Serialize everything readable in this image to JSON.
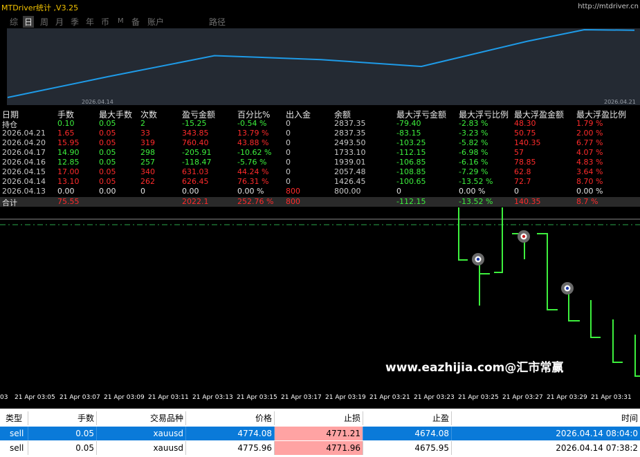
{
  "app": {
    "title": "MTDriver统计 ,V3.25",
    "site": "http://mtdriver.cn"
  },
  "tabs": [
    "综",
    "日",
    "周",
    "月",
    "季",
    "年",
    "币",
    "M",
    "备",
    "账户",
    "路径"
  ],
  "active_tab": "日",
  "curve": {
    "date_left": "2026.04.14",
    "date_right": "2026.04.21",
    "line_color": "#1e9be8",
    "values": [
      0,
      626.45,
      1257.48,
      1139.01,
      933.1,
      1693.5,
      2037.35,
      2022.1
    ]
  },
  "stats": {
    "headers": [
      "日期",
      "手数",
      "最大手数",
      "次数",
      "盈亏金额",
      "百分比%",
      "出入金",
      "余额",
      "最大浮亏金额",
      "最大浮亏比例",
      "最大浮盈金额",
      "最大浮盈比例"
    ],
    "rows": [
      {
        "date": "持仓",
        "lots": "0.10",
        "max_lots": "0.05",
        "count": "2",
        "pnl": "-15.25",
        "pct": "-0.54 %",
        "inout": "0",
        "balance": "2837.35",
        "max_dd": "-79.40",
        "max_dd_pct": "-2.83 %",
        "max_fp": "48.30",
        "max_fp_pct": "1.79 %",
        "tone": "g"
      },
      {
        "date": "2026.04.21",
        "lots": "1.65",
        "max_lots": "0.05",
        "count": "33",
        "pnl": "343.85",
        "pct": "13.79 %",
        "inout": "0",
        "balance": "2837.35",
        "max_dd": "-83.15",
        "max_dd_pct": "-3.23 %",
        "max_fp": "50.75",
        "max_fp_pct": "2.00 %",
        "tone": "r"
      },
      {
        "date": "2026.04.20",
        "lots": "15.95",
        "max_lots": "0.05",
        "count": "319",
        "pnl": "760.40",
        "pct": "43.88 %",
        "inout": "0",
        "balance": "2493.50",
        "max_dd": "-103.25",
        "max_dd_pct": "-5.82 %",
        "max_fp": "140.35",
        "max_fp_pct": "6.77 %",
        "tone": "r"
      },
      {
        "date": "2026.04.17",
        "lots": "14.90",
        "max_lots": "0.05",
        "count": "298",
        "pnl": "-205.91",
        "pct": "-10.62 %",
        "inout": "0",
        "balance": "1733.10",
        "max_dd": "-112.15",
        "max_dd_pct": "-6.98 %",
        "max_fp": "57",
        "max_fp_pct": "4.07 %",
        "tone": "g"
      },
      {
        "date": "2026.04.16",
        "lots": "12.85",
        "max_lots": "0.05",
        "count": "257",
        "pnl": "-118.47",
        "pct": "-5.76 %",
        "inout": "0",
        "balance": "1939.01",
        "max_dd": "-106.85",
        "max_dd_pct": "-6.16 %",
        "max_fp": "78.85",
        "max_fp_pct": "4.83 %",
        "tone": "g"
      },
      {
        "date": "2026.04.15",
        "lots": "17.00",
        "max_lots": "0.05",
        "count": "340",
        "pnl": "631.03",
        "pct": "44.24 %",
        "inout": "0",
        "balance": "2057.48",
        "max_dd": "-108.85",
        "max_dd_pct": "-7.29 %",
        "max_fp": "62.8",
        "max_fp_pct": "3.64 %",
        "tone": "r"
      },
      {
        "date": "2026.04.14",
        "lots": "13.10",
        "max_lots": "0.05",
        "count": "262",
        "pnl": "626.45",
        "pct": "76.31 %",
        "inout": "0",
        "balance": "1426.45",
        "max_dd": "-100.65",
        "max_dd_pct": "-13.52 %",
        "max_fp": "72.7",
        "max_fp_pct": "8.70 %",
        "tone": "r"
      },
      {
        "date": "2026.04.13",
        "lots": "0.00",
        "max_lots": "0.00",
        "count": "0",
        "pnl": "0.00",
        "pct": "0.00 %",
        "inout": "800",
        "balance": "800.00",
        "max_dd": "0",
        "max_dd_pct": "0.00 %",
        "max_fp": "0",
        "max_fp_pct": "0.00 %",
        "tone": "w"
      }
    ],
    "total": {
      "date": "合计",
      "lots": "75.55",
      "max_lots": "",
      "count": "",
      "pnl": "2022.1",
      "pct": "252.76 %",
      "inout": "800",
      "balance": "",
      "max_dd": "-112.15",
      "max_dd_pct": "-13.52 %",
      "max_fp": "140.35",
      "max_fp_pct": "8.7 %"
    }
  },
  "watermark": "www.eazhijia.com@汇市常赢",
  "time_axis": [
    "03",
    "21 Apr 03:05",
    "21 Apr 03:07",
    "21 Apr 03:09",
    "21 Apr 03:11",
    "21 Apr 03:13",
    "21 Apr 03:15",
    "21 Apr 03:17",
    "21 Apr 03:19",
    "21 Apr 03:21",
    "21 Apr 03:23",
    "21 Apr 03:25",
    "21 Apr 03:27",
    "21 Apr 03:29",
    "21 Apr 03:31"
  ],
  "orders": {
    "headers": [
      "类型",
      "手数",
      "交易品种",
      "价格",
      "止损",
      "止盈",
      "时间"
    ],
    "rows": [
      {
        "type": "sell",
        "lots": "0.05",
        "symbol": "xauusd",
        "price": "4774.08",
        "sl": "4771.21",
        "tp": "4674.08",
        "time": "2026.04.14 08:04:0"
      },
      {
        "type": "sell",
        "lots": "0.05",
        "symbol": "xauusd",
        "price": "4775.96",
        "sl": "4771.96",
        "tp": "4675.95",
        "time": "2026.04.14 07:38:2"
      }
    ]
  }
}
